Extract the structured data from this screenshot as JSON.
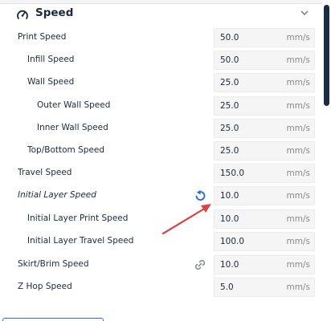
{
  "section": {
    "title": "Speed",
    "icon": "speedometer-icon",
    "chevron": "chevron-down-icon"
  },
  "rows": [
    {
      "label": "Print Speed",
      "value": "50.0",
      "unit": "mm/s"
    },
    {
      "label": "Infill Speed",
      "value": "50.0",
      "unit": "mm/s"
    },
    {
      "label": "Wall Speed",
      "value": "25.0",
      "unit": "mm/s"
    },
    {
      "label": "Outer Wall Speed",
      "value": "25.0",
      "unit": "mm/s"
    },
    {
      "label": "Inner Wall Speed",
      "value": "25.0",
      "unit": "mm/s"
    },
    {
      "label": "Top/Bottom Speed",
      "value": "25.0",
      "unit": "mm/s"
    },
    {
      "label": "Travel Speed",
      "value": "150.0",
      "unit": "mm/s"
    },
    {
      "label": "Initial Layer Speed",
      "value": "10.0",
      "unit": "mm/s",
      "icon": "reset-icon"
    },
    {
      "label": "Initial Layer Print Speed",
      "value": "10.0",
      "unit": "mm/s"
    },
    {
      "label": "Initial Layer Travel Speed",
      "value": "100.0",
      "unit": "mm/s"
    },
    {
      "label": "Skirt/Brim Speed",
      "value": "10.0",
      "unit": "mm/s",
      "icon": "link-icon"
    },
    {
      "label": "Z Hop Speed",
      "value": "5.0",
      "unit": "mm/s"
    }
  ],
  "colors": {
    "accent": "#2e6fd1",
    "annotation_arrow": "#d64545",
    "scroll_thumb": "#1c2b45"
  }
}
